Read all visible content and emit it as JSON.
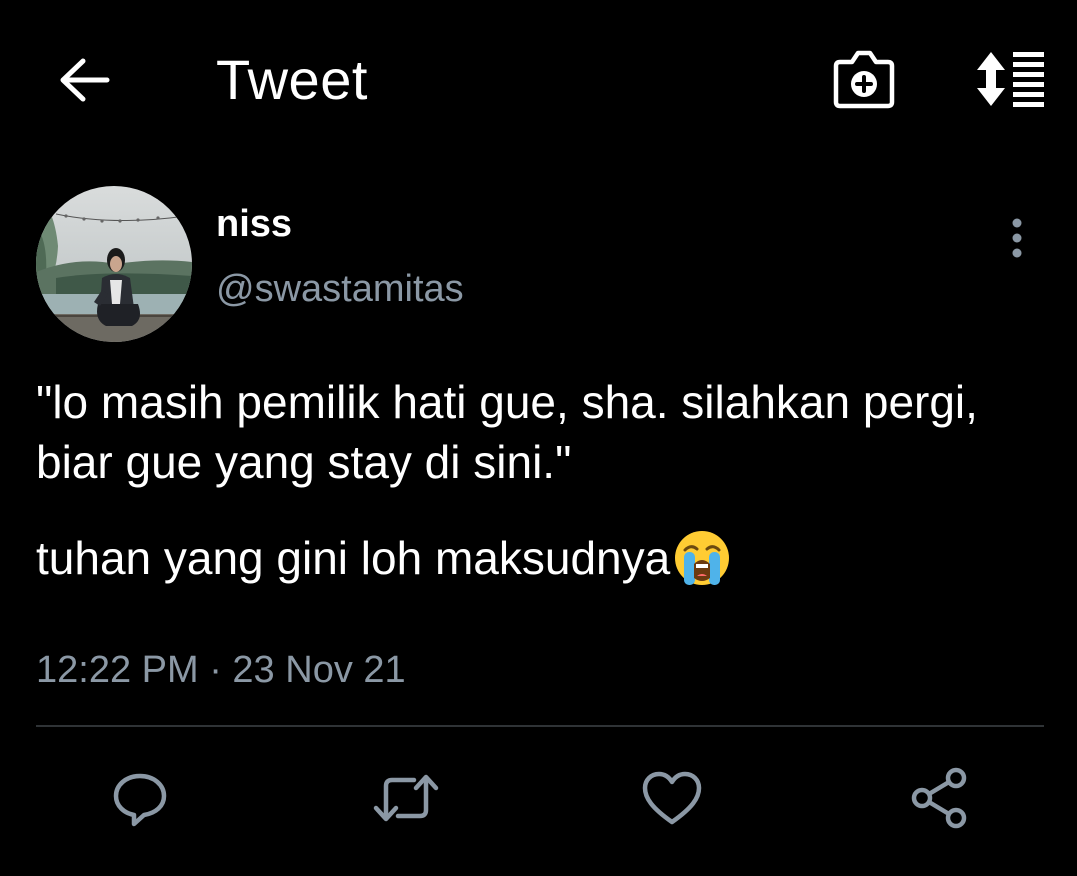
{
  "header": {
    "title": "Tweet",
    "back_icon": "arrow-left-icon",
    "camera_icon": "camera-add-icon",
    "sort_icon": "sort-list-icon"
  },
  "author": {
    "name": "niss",
    "handle": "@swastamitas",
    "avatar": "profile-photo",
    "more_icon": "more-vertical-icon"
  },
  "tweet": {
    "text_line1": "\"lo masih pemilik hati gue, sha. silahkan pergi, biar gue yang stay di sini.\"",
    "text_line2": "tuhan yang gini loh maksudnya",
    "emoji": "loudly-crying-face-emoji",
    "timestamp": "12:22 PM · 23 Nov 21"
  },
  "actions": [
    {
      "name": "reply",
      "icon": "comment-icon"
    },
    {
      "name": "retweet",
      "icon": "retweet-icon"
    },
    {
      "name": "like",
      "icon": "heart-icon"
    },
    {
      "name": "share",
      "icon": "share-icon"
    }
  ],
  "colors": {
    "background": "#000000",
    "text": "#ffffff",
    "secondary": "#8b98a5",
    "divider": "#2f3336"
  }
}
